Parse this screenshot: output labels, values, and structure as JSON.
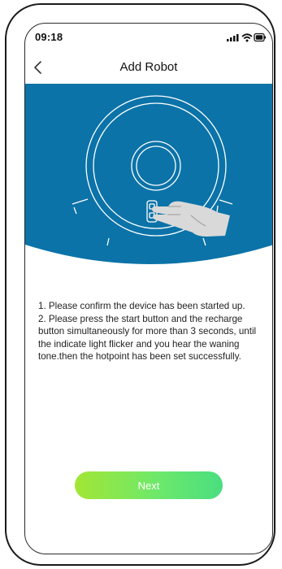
{
  "status_bar": {
    "time": "09:18"
  },
  "header": {
    "title": "Add Robot",
    "back_icon": "chevron-left-icon"
  },
  "illustration": {
    "background_color": "#0b73a8",
    "subject": "robot-vacuum-with-hand-pressing-buttons"
  },
  "instructions": {
    "step1": "1. Please confirm the device has been started up.",
    "step2": "2. Please press the start button and the recharge button simultaneously for more than 3 seconds, until the indicate light flicker and you hear the waning tone.then the hotpoint has been set successfully."
  },
  "actions": {
    "next_label": "Next"
  },
  "colors": {
    "accent_gradient_start": "#a3e635",
    "accent_gradient_end": "#4ade80",
    "illustration_blue": "#0b73a8"
  }
}
